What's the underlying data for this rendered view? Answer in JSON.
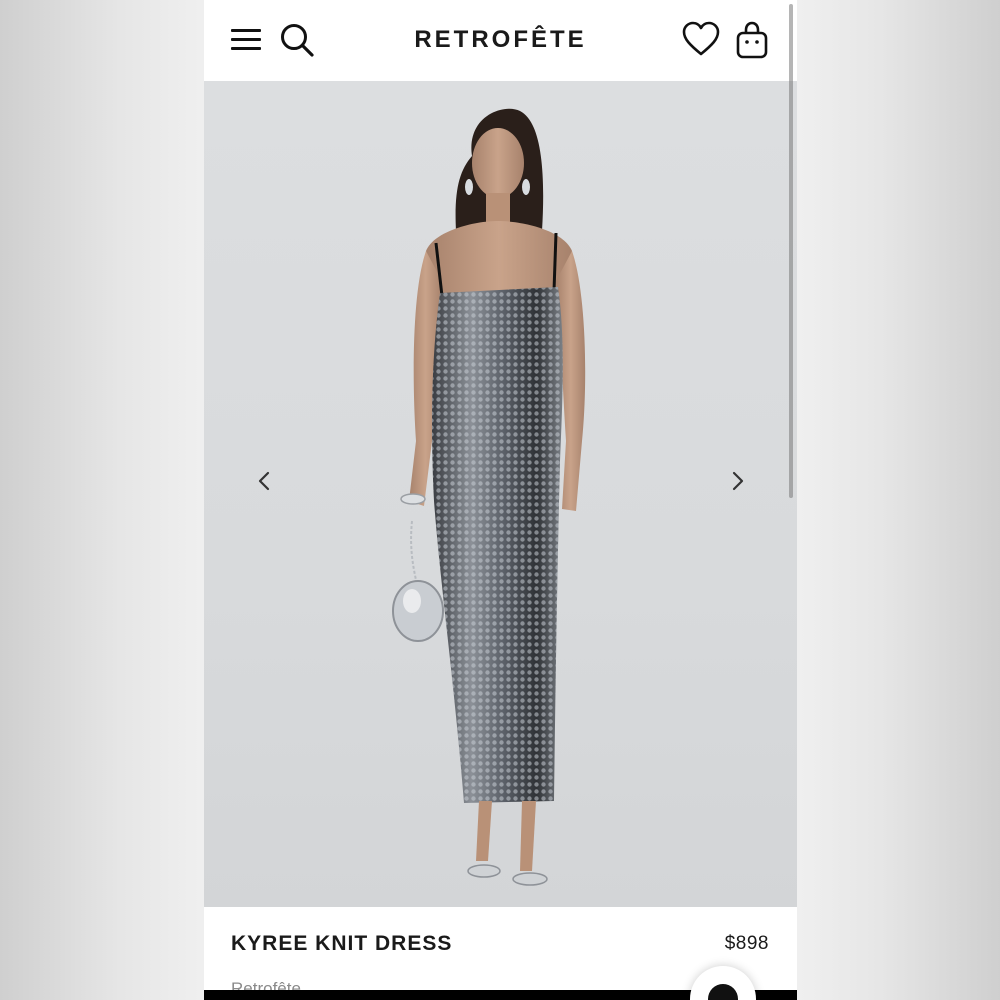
{
  "header": {
    "logo": "RETROFÊTE",
    "icons": [
      "menu-icon",
      "search-icon",
      "heart-icon",
      "bag-icon"
    ]
  },
  "gallery": {
    "image_subject": "product-photo",
    "prev_icon": "chevron-left-icon",
    "next_icon": "chevron-right-icon"
  },
  "product": {
    "title": "KYREE KNIT DRESS",
    "price": "$898",
    "brand": "Retrofête"
  },
  "chat": {
    "icon": "chat-icon"
  },
  "colors": {
    "text": "#1a1a1a",
    "muted": "#8a8a8a",
    "background": "#ffffff"
  }
}
